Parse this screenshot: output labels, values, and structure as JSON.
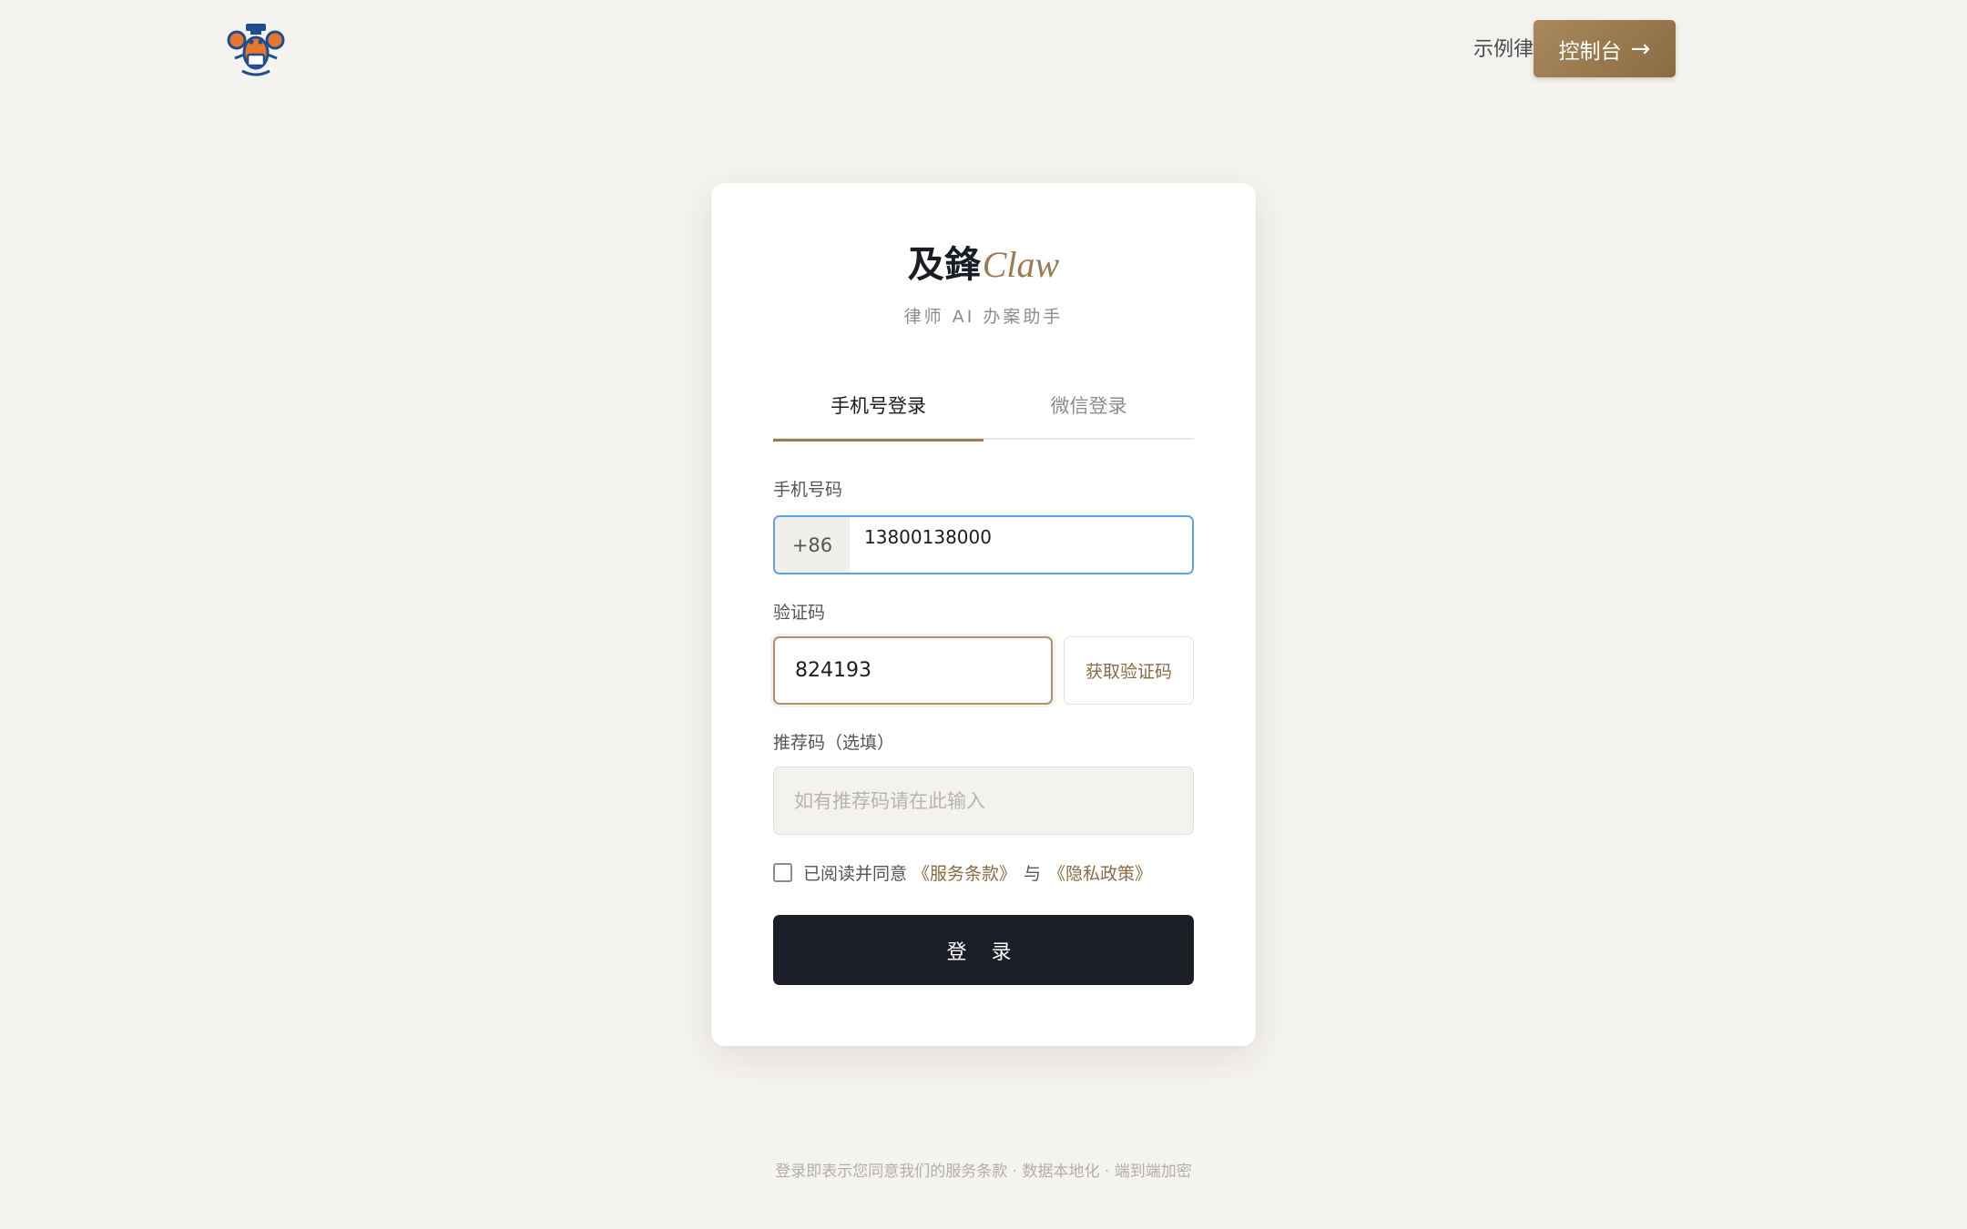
{
  "header": {
    "nav": [
      "",
      "",
      "",
      "",
      ""
    ],
    "demo_lawyer": "示例律师",
    "console_label": "控制台",
    "console_arrow": "→"
  },
  "card": {
    "brand_cn": "及鋒",
    "brand_en": "Claw",
    "subtitle": "律师 AI 办案助手",
    "tabs": [
      {
        "label": "手机号登录",
        "active": true
      },
      {
        "label": "微信登录",
        "active": false
      }
    ],
    "phone": {
      "label": "手机号码",
      "country_code": "+86",
      "value": "13800138000"
    },
    "code": {
      "label": "验证码",
      "value": "824193",
      "get_code_label": "获取验证码"
    },
    "referral": {
      "label": "推荐码（选填）",
      "placeholder": "如有推荐码请在此输入"
    },
    "agreement": {
      "prefix": "已阅读并同意",
      "terms": "《服务条款》",
      "and": "与",
      "privacy": "《隐私政策》",
      "checked": false
    },
    "login_label": "登 录"
  },
  "footer": "登录即表示您同意我们的服务条款 · 数据本地化 · 端到端加密",
  "colors": {
    "accent": "#9b7b52",
    "focus_blue": "#5aa3e6",
    "dark_button": "#1b1e26",
    "background": "#f5f3ef"
  }
}
